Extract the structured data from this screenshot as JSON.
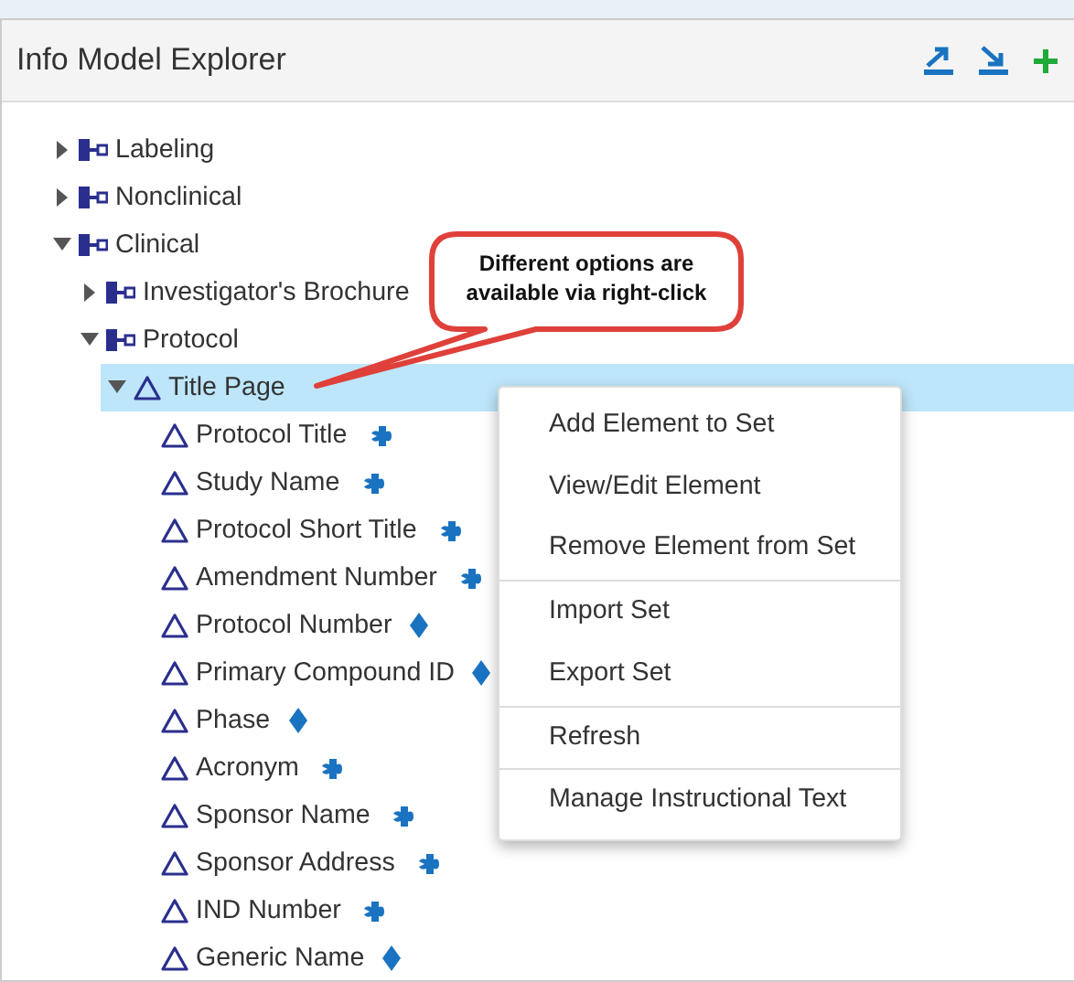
{
  "panel": {
    "title": "Info Model Explorer"
  },
  "tree": [
    {
      "label": "Labeling",
      "kind": "group",
      "expanded": false,
      "selected": false
    },
    {
      "label": "Nonclinical",
      "kind": "group",
      "expanded": false,
      "selected": false
    },
    {
      "label": "Clinical",
      "kind": "group",
      "expanded": true,
      "selected": false,
      "children": [
        {
          "label": "Investigator's Brochure",
          "kind": "group",
          "expanded": false,
          "selected": false
        },
        {
          "label": "Protocol",
          "kind": "group",
          "expanded": true,
          "selected": false,
          "children": [
            {
              "label": "Title Page",
              "kind": "element",
              "expanded": true,
              "selected": true,
              "children": [
                {
                  "label": "Protocol Title",
                  "kind": "puzzle",
                  "selected": false
                },
                {
                  "label": "Study Name",
                  "kind": "puzzle",
                  "selected": false
                },
                {
                  "label": "Protocol Short Title",
                  "kind": "puzzle",
                  "selected": false
                },
                {
                  "label": "Amendment Number",
                  "kind": "puzzle",
                  "selected": false
                },
                {
                  "label": "Protocol Number",
                  "kind": "diamond",
                  "selected": false
                },
                {
                  "label": "Primary Compound ID",
                  "kind": "diamond",
                  "selected": false
                },
                {
                  "label": "Phase",
                  "kind": "diamond",
                  "selected": false
                },
                {
                  "label": "Acronym",
                  "kind": "puzzle",
                  "selected": false
                },
                {
                  "label": "Sponsor Name",
                  "kind": "puzzle",
                  "selected": false
                },
                {
                  "label": "Sponsor Address",
                  "kind": "puzzle",
                  "selected": false
                },
                {
                  "label": "IND Number",
                  "kind": "puzzle",
                  "selected": false
                },
                {
                  "label": "Generic Name",
                  "kind": "diamond",
                  "selected": false
                }
              ]
            }
          ]
        }
      ]
    }
  ],
  "callout": {
    "text": "Different options are available via right-click"
  },
  "context_menu": {
    "groups": [
      [
        "Add Element to Set",
        "View/Edit Element",
        "Remove Element from Set"
      ],
      [
        "Import Set",
        "Export Set"
      ],
      [
        "Refresh"
      ],
      [
        "Manage Instructional Text"
      ]
    ]
  }
}
